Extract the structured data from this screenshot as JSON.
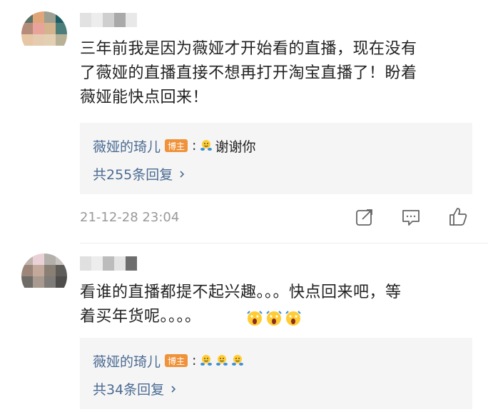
{
  "comments": [
    {
      "text": "三年前我是因为薇娅才开始看的直播，现在没有\n了薇娅的直播直接不想再打开淘宝直播了！盼着\n薇娅能快点回来！",
      "reply": {
        "author": "薇娅的琦儿",
        "badge": "博主",
        "colon": ":",
        "message": "谢谢你",
        "count_label": "共255条回复"
      },
      "time": "21-12-28 23:04"
    },
    {
      "text": "看谁的直播都提不起兴趣。。。快点回来吧，等\n着买年货呢。。。。",
      "reply": {
        "author": "薇娅的琦儿",
        "badge": "博主",
        "colon": ":",
        "count_label": "共34条回复"
      }
    }
  ],
  "icons": {
    "share": "share-icon",
    "comment": "comment-icon",
    "like": "like-icon",
    "chevron": "chevron-right-icon"
  }
}
